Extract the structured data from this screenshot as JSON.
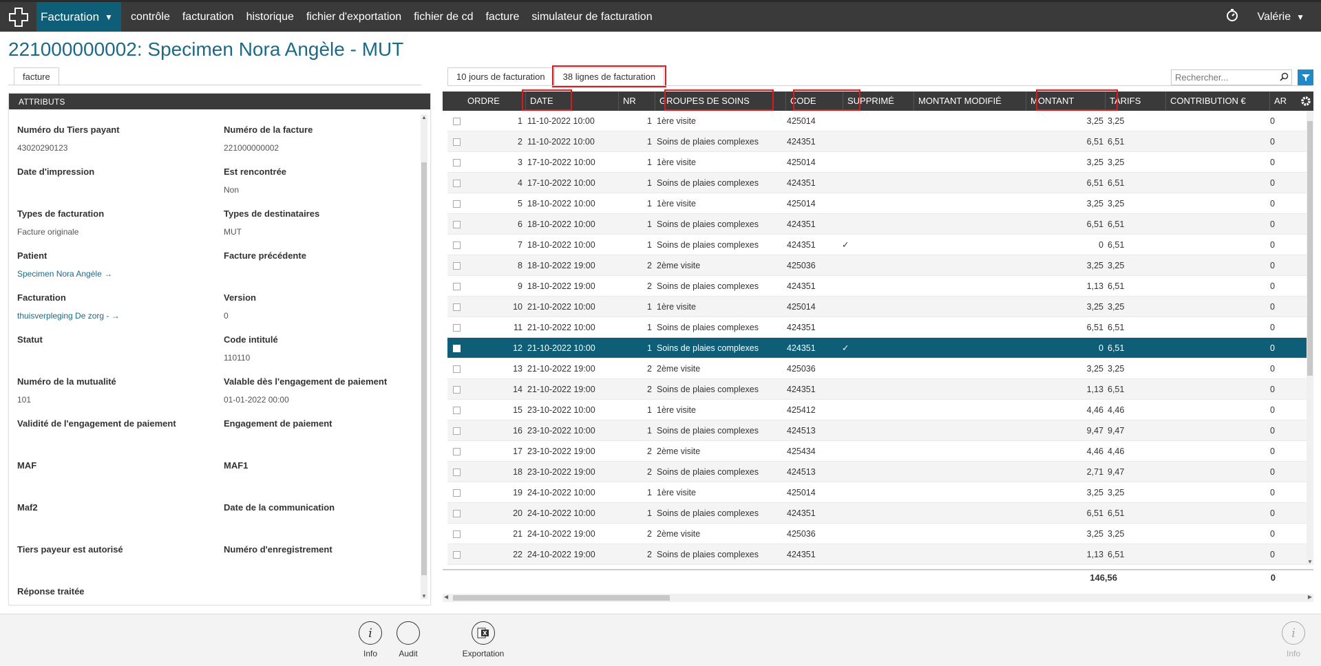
{
  "topbar": {
    "app_label": "Facturation",
    "nav": [
      "contrôle",
      "facturation",
      "historique",
      "fichier d'exportation",
      "fichier de cd",
      "facture",
      "simulateur de facturation"
    ],
    "user": "Valérie"
  },
  "page_title": "221000000002: Specimen Nora Angèle - MUT",
  "left_tab": "facture",
  "attributes": {
    "header": "ATTRIBUTS",
    "fields": [
      {
        "label": "Numéro du Tiers payant",
        "value": "43020290123",
        "link": false
      },
      {
        "label": "Numéro de la facture",
        "value": "221000000002",
        "link": false
      },
      {
        "label": "Date d'impression",
        "value": "",
        "link": false
      },
      {
        "label": "Est rencontrée",
        "value": "Non",
        "link": false
      },
      {
        "label": "Types de facturation",
        "value": "Facture originale",
        "link": false
      },
      {
        "label": "Types de destinataires",
        "value": "MUT",
        "link": false
      },
      {
        "label": "Patient",
        "value": "Specimen Nora Angèle →",
        "link": true
      },
      {
        "label": "Facture précédente",
        "value": "",
        "link": false
      },
      {
        "label": "Facturation",
        "value": "thuisverpleging De zorg - →",
        "link": true
      },
      {
        "label": "Version",
        "value": "0",
        "link": false
      },
      {
        "label": "Statut",
        "value": "",
        "link": false
      },
      {
        "label": "Code intitulé",
        "value": "110110",
        "link": false
      },
      {
        "label": "Numéro de la mutualité",
        "value": "101",
        "link": false
      },
      {
        "label": "Valable dès l'engagement de paiement",
        "value": "01-01-2022 00:00",
        "link": false
      },
      {
        "label": "Validité de l'engagement de paiement",
        "value": "",
        "link": false
      },
      {
        "label": "Engagement de paiement",
        "value": "",
        "link": false
      },
      {
        "label": "MAF",
        "value": "",
        "link": false
      },
      {
        "label": "MAF1",
        "value": "",
        "link": false
      },
      {
        "label": "Maf2",
        "value": "",
        "link": false
      },
      {
        "label": "Date de la communication",
        "value": "",
        "link": false
      },
      {
        "label": "Tiers payeur est autorisé",
        "value": "",
        "link": false
      },
      {
        "label": "Numéro d'enregistrement",
        "value": "",
        "link": false
      },
      {
        "label": "Réponse traitée",
        "value": "",
        "link": false
      }
    ]
  },
  "right_tabs": [
    "10 jours de facturation",
    "38 lignes de facturation"
  ],
  "search": {
    "placeholder": "Rechercher..."
  },
  "grid": {
    "columns": [
      "ORDRE",
      "DATE",
      "NR",
      "GROUPES DE SOINS",
      "CODE",
      "SUPPRIMÉ",
      "MONTANT MODIFIÉ",
      "MONTANT",
      "TARIFS",
      "CONTRIBUTION €",
      "AR"
    ],
    "rows": [
      {
        "ordre": "1",
        "date": "11-10-2022 10:00",
        "nr": "1",
        "groupe": "1ère visite",
        "code": "425014",
        "supprime": "",
        "montant": "3,25",
        "tarifs": "3,25",
        "contribution": "0"
      },
      {
        "ordre": "2",
        "date": "11-10-2022 10:00",
        "nr": "1",
        "groupe": "Soins de plaies complexes",
        "code": "424351",
        "supprime": "",
        "montant": "6,51",
        "tarifs": "6,51",
        "contribution": "0"
      },
      {
        "ordre": "3",
        "date": "17-10-2022 10:00",
        "nr": "1",
        "groupe": "1ère visite",
        "code": "425014",
        "supprime": "",
        "montant": "3,25",
        "tarifs": "3,25",
        "contribution": "0"
      },
      {
        "ordre": "4",
        "date": "17-10-2022 10:00",
        "nr": "1",
        "groupe": "Soins de plaies complexes",
        "code": "424351",
        "supprime": "",
        "montant": "6,51",
        "tarifs": "6,51",
        "contribution": "0"
      },
      {
        "ordre": "5",
        "date": "18-10-2022 10:00",
        "nr": "1",
        "groupe": "1ère visite",
        "code": "425014",
        "supprime": "",
        "montant": "3,25",
        "tarifs": "3,25",
        "contribution": "0"
      },
      {
        "ordre": "6",
        "date": "18-10-2022 10:00",
        "nr": "1",
        "groupe": "Soins de plaies complexes",
        "code": "424351",
        "supprime": "",
        "montant": "6,51",
        "tarifs": "6,51",
        "contribution": "0"
      },
      {
        "ordre": "7",
        "date": "18-10-2022 10:00",
        "nr": "1",
        "groupe": "Soins de plaies complexes",
        "code": "424351",
        "supprime": "✓",
        "montant": "0",
        "tarifs": "6,51",
        "contribution": "0"
      },
      {
        "ordre": "8",
        "date": "18-10-2022 19:00",
        "nr": "2",
        "groupe": "2ème visite",
        "code": "425036",
        "supprime": "",
        "montant": "3,25",
        "tarifs": "3,25",
        "contribution": "0"
      },
      {
        "ordre": "9",
        "date": "18-10-2022 19:00",
        "nr": "2",
        "groupe": "Soins de plaies complexes",
        "code": "424351",
        "supprime": "",
        "montant": "1,13",
        "tarifs": "6,51",
        "contribution": "0"
      },
      {
        "ordre": "10",
        "date": "21-10-2022 10:00",
        "nr": "1",
        "groupe": "1ère visite",
        "code": "425014",
        "supprime": "",
        "montant": "3,25",
        "tarifs": "3,25",
        "contribution": "0"
      },
      {
        "ordre": "11",
        "date": "21-10-2022 10:00",
        "nr": "1",
        "groupe": "Soins de plaies complexes",
        "code": "424351",
        "supprime": "",
        "montant": "6,51",
        "tarifs": "6,51",
        "contribution": "0"
      },
      {
        "ordre": "12",
        "date": "21-10-2022 10:00",
        "nr": "1",
        "groupe": "Soins de plaies complexes",
        "code": "424351",
        "supprime": "✓",
        "montant": "0",
        "tarifs": "6,51",
        "contribution": "0"
      },
      {
        "ordre": "13",
        "date": "21-10-2022 19:00",
        "nr": "2",
        "groupe": "2ème visite",
        "code": "425036",
        "supprime": "",
        "montant": "3,25",
        "tarifs": "3,25",
        "contribution": "0"
      },
      {
        "ordre": "14",
        "date": "21-10-2022 19:00",
        "nr": "2",
        "groupe": "Soins de plaies complexes",
        "code": "424351",
        "supprime": "",
        "montant": "1,13",
        "tarifs": "6,51",
        "contribution": "0"
      },
      {
        "ordre": "15",
        "date": "23-10-2022 10:00",
        "nr": "1",
        "groupe": "1ère visite",
        "code": "425412",
        "supprime": "",
        "montant": "4,46",
        "tarifs": "4,46",
        "contribution": "0"
      },
      {
        "ordre": "16",
        "date": "23-10-2022 10:00",
        "nr": "1",
        "groupe": "Soins de plaies complexes",
        "code": "424513",
        "supprime": "",
        "montant": "9,47",
        "tarifs": "9,47",
        "contribution": "0"
      },
      {
        "ordre": "17",
        "date": "23-10-2022 19:00",
        "nr": "2",
        "groupe": "2ème visite",
        "code": "425434",
        "supprime": "",
        "montant": "4,46",
        "tarifs": "4,46",
        "contribution": "0"
      },
      {
        "ordre": "18",
        "date": "23-10-2022 19:00",
        "nr": "2",
        "groupe": "Soins de plaies complexes",
        "code": "424513",
        "supprime": "",
        "montant": "2,71",
        "tarifs": "9,47",
        "contribution": "0"
      },
      {
        "ordre": "19",
        "date": "24-10-2022 10:00",
        "nr": "1",
        "groupe": "1ère visite",
        "code": "425014",
        "supprime": "",
        "montant": "3,25",
        "tarifs": "3,25",
        "contribution": "0"
      },
      {
        "ordre": "20",
        "date": "24-10-2022 10:00",
        "nr": "1",
        "groupe": "Soins de plaies complexes",
        "code": "424351",
        "supprime": "",
        "montant": "6,51",
        "tarifs": "6,51",
        "contribution": "0"
      },
      {
        "ordre": "21",
        "date": "24-10-2022 19:00",
        "nr": "2",
        "groupe": "2ème visite",
        "code": "425036",
        "supprime": "",
        "montant": "3,25",
        "tarifs": "3,25",
        "contribution": "0"
      },
      {
        "ordre": "22",
        "date": "24-10-2022 19:00",
        "nr": "2",
        "groupe": "Soins de plaies complexes",
        "code": "424351",
        "supprime": "",
        "montant": "1,13",
        "tarifs": "6,51",
        "contribution": "0"
      }
    ],
    "selected_row_index": 11,
    "totals": {
      "montant": "146,56",
      "contribution": "0"
    }
  },
  "bottom_actions": [
    {
      "label": "Info",
      "icon": "info-icon"
    },
    {
      "label": "Audit",
      "icon": "audit-icon"
    },
    {
      "label": "Exportation",
      "icon": "excel-export-icon"
    }
  ],
  "bottom_right": {
    "label": "Info",
    "icon": "info-icon"
  },
  "colors": {
    "brand": "#0e5e78",
    "topbar": "#3a3a3a",
    "highlight_box": "#e0181e",
    "filter": "#1f8ac9"
  }
}
